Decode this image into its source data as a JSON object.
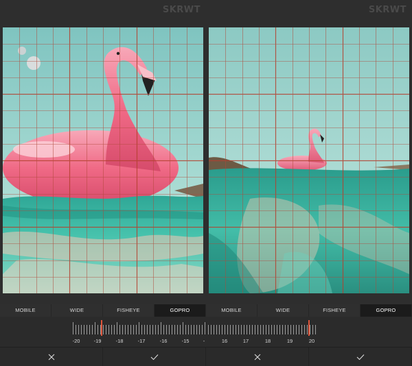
{
  "app": {
    "brand": "SKRWT"
  },
  "panels": [
    {
      "id": "left",
      "tabs": [
        {
          "label": "MOBILE",
          "active": false
        },
        {
          "label": "WIDE",
          "active": false
        },
        {
          "label": "FISHEYE",
          "active": false
        },
        {
          "label": "GOPRO",
          "active": true
        }
      ],
      "ruler": {
        "labels": [
          "-20",
          "-19",
          "-18",
          "-17",
          "-16",
          "-15",
          "-",
          "16",
          "17",
          "18",
          "19",
          "20"
        ],
        "selected": "-19"
      },
      "actions": {
        "cancel_icon": "close-icon",
        "confirm_icon": "check-icon"
      }
    },
    {
      "id": "right",
      "tabs": [
        {
          "label": "MOBILE",
          "active": false
        },
        {
          "label": "WIDE",
          "active": false
        },
        {
          "label": "FISHEYE",
          "active": false
        },
        {
          "label": "GOPRO",
          "active": true
        }
      ],
      "ruler": {
        "labels": [],
        "selected": "20"
      },
      "actions": {
        "cancel_icon": "close-icon",
        "confirm_icon": "check-icon"
      }
    }
  ],
  "colors": {
    "accent": "#e0553a",
    "grid": "#b0483a",
    "sky": "#a8d6cf",
    "water": "#3fb7a2",
    "flamingo": "#f06a86"
  }
}
